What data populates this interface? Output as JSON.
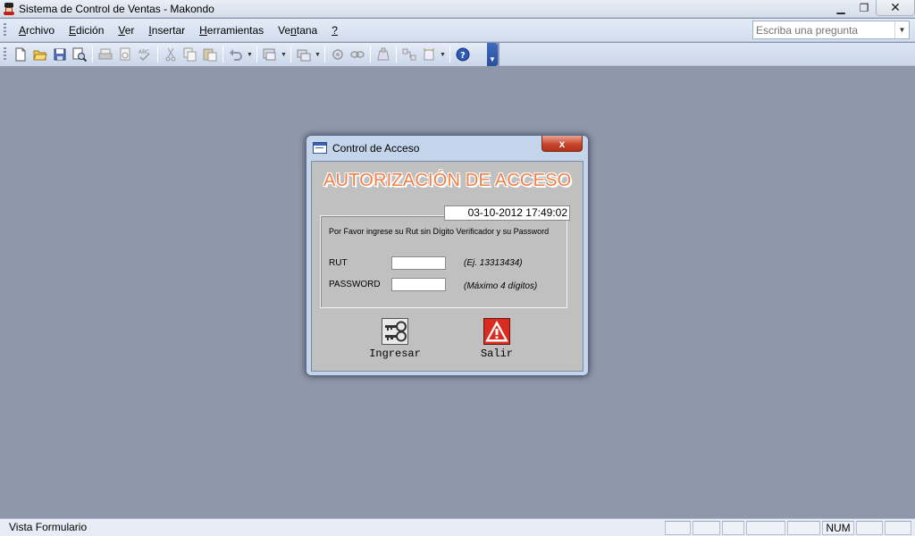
{
  "window": {
    "title": "Sistema de Control de Ventas - Makondo",
    "controls": {
      "minimize": "▁",
      "restore": "❐",
      "close": "✕"
    }
  },
  "menu": {
    "items": [
      {
        "label": "Archivo",
        "accel": "A",
        "rest": "rchivo"
      },
      {
        "label": "Edición",
        "accel": "E",
        "rest": "dición"
      },
      {
        "label": "Ver",
        "accel": "V",
        "rest": "er"
      },
      {
        "label": "Insertar",
        "accel": "I",
        "rest": "nsertar"
      },
      {
        "label": "Herramientas",
        "accel": "H",
        "rest": "erramientas"
      },
      {
        "label": "Ventana",
        "pre": "Ve",
        "accel": "n",
        "rest": "tana"
      },
      {
        "label": "?",
        "accel": "?",
        "rest": ""
      }
    ],
    "help_placeholder": "Escriba una pregunta"
  },
  "toolbar": {
    "buttons": [
      "new-document-icon",
      "open-folder-icon",
      "save-icon",
      "search-icon",
      "print-icon",
      "print-preview-icon",
      "spelling-icon",
      "cut-icon",
      "copy-icon",
      "paste-icon",
      "undo-icon",
      "view-icon",
      "objects-icon",
      "properties-icon",
      "link-icon",
      "build-icon",
      "relationships-icon",
      "new-object-icon",
      "help-icon"
    ]
  },
  "dialog": {
    "title": "Control de Acceso",
    "close_label": "x",
    "heading": "AUTORIZACIÓN DE ACCESO",
    "datetime": "03-10-2012 17:49:02",
    "instructions": "Por Favor ingrese su Rut sin Dígito Verificador y su Password",
    "rut_label": "RUT",
    "rut_value": "",
    "rut_hint": "(Ej. 13313434)",
    "password_label": "PASSWORD",
    "password_value": "",
    "password_hint": "(Máximo 4 dígitos)",
    "ingresar_label": "Ingresar",
    "salir_label": "Salir"
  },
  "status": {
    "text": "Vista Formulario",
    "num": "NUM"
  },
  "colors": {
    "workspace": "#8f97ab",
    "heading": "#f08048",
    "dialog_body": "#c0c0c0"
  }
}
